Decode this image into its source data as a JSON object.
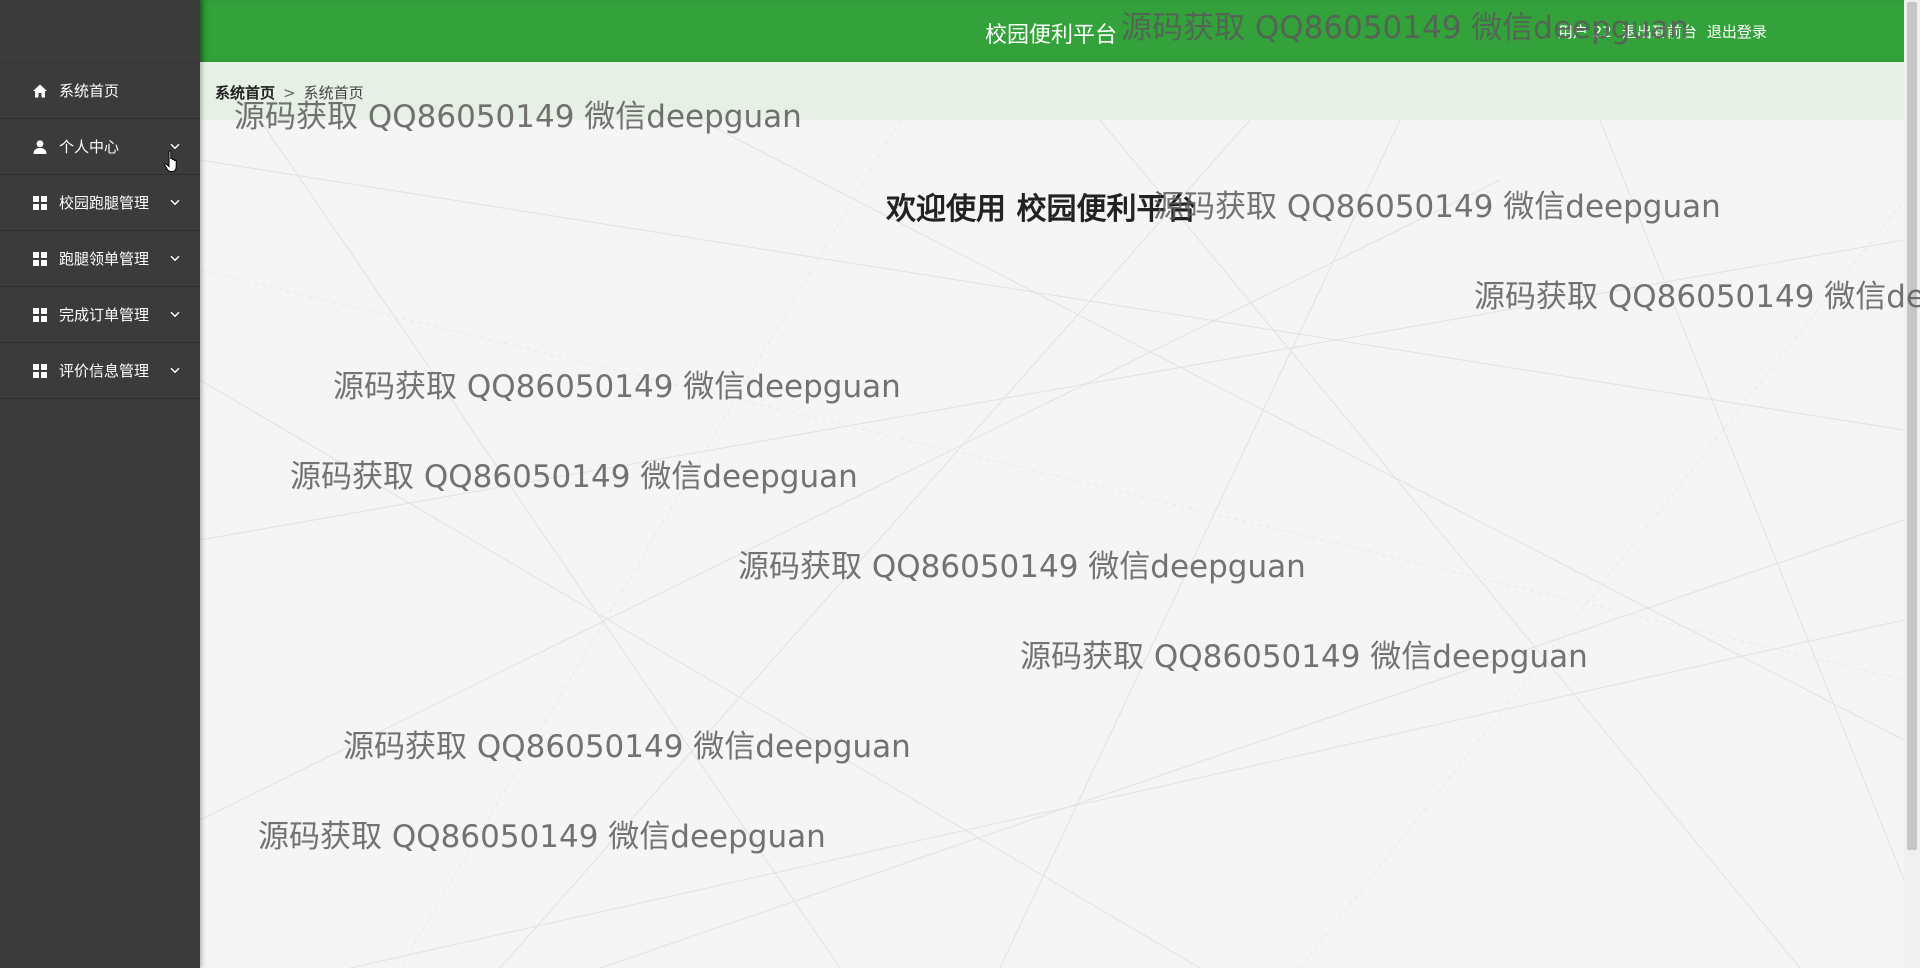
{
  "header": {
    "title": "校园便利平台",
    "user_label": "用户 22",
    "to_front_label": "退出到前台",
    "logout_label": "退出登录",
    "bg_color": "#33a23a"
  },
  "sidebar": {
    "items": [
      {
        "label": "系统首页",
        "icon": "home-icon"
      },
      {
        "label": "个人中心",
        "icon": "user-icon"
      },
      {
        "label": "校园跑腿管理",
        "icon": "grid-icon"
      },
      {
        "label": "跑腿领单管理",
        "icon": "grid-icon"
      },
      {
        "label": "完成订单管理",
        "icon": "grid-icon"
      },
      {
        "label": "评价信息管理",
        "icon": "grid-icon"
      }
    ],
    "bg_color": "#3b3b3b"
  },
  "breadcrumb": {
    "home": "系统首页",
    "separator": ">",
    "current": "系统首页"
  },
  "main": {
    "welcome_text": "欢迎使用 校园便利平台"
  },
  "watermark": {
    "text": "源码获取 QQ86050149 微信deepguan"
  }
}
